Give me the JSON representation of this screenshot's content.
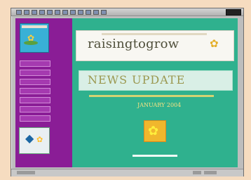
{
  "browser": {
    "toolbar_icons": [
      "back-icon",
      "forward-icon",
      "stop-icon",
      "refresh-icon",
      "home-icon",
      "search-icon",
      "favorites-icon",
      "history-icon",
      "mail-icon",
      "print-icon",
      "edit-icon",
      "discuss-icon"
    ]
  },
  "site": {
    "logo_name": "raising to grow",
    "banner_title": "raisingtogrow",
    "news_title": "NEWS UPDATE",
    "date": "JANUARY 2004",
    "nav_items": [
      "",
      "",
      "",
      "",
      "",
      "",
      ""
    ]
  },
  "colors": {
    "sidebar": "#8a1d96",
    "main": "#2fb18e"
  }
}
